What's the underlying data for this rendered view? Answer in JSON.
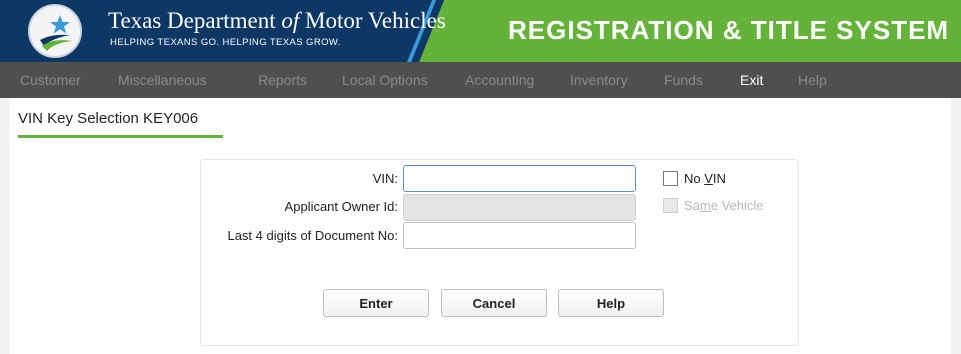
{
  "header": {
    "brand_title_pre": "Texas Department ",
    "brand_title_of": "of",
    "brand_title_post": " Motor Vehicles",
    "tagline": "HELPING TEXANS GO. HELPING TEXAS GROW.",
    "system_title": "REGISTRATION & TITLE SYSTEM",
    "colors": {
      "navy": "#0d3764",
      "green": "#64b23a"
    },
    "logo_icon": "txdmv-star-logo"
  },
  "menu": {
    "items": [
      {
        "label": "Customer",
        "active": false
      },
      {
        "label": "Miscellaneous",
        "active": false
      },
      {
        "label": "Reports",
        "active": false
      },
      {
        "label": "Local Options",
        "active": false
      },
      {
        "label": "Accounting",
        "active": false
      },
      {
        "label": "Inventory",
        "active": false
      },
      {
        "label": "Funds",
        "active": false
      },
      {
        "label": "Exit",
        "active": true
      },
      {
        "label": "Help",
        "active": false
      }
    ]
  },
  "page": {
    "title": "VIN Key Selection KEY006"
  },
  "form": {
    "vin": {
      "label": "VIN:",
      "value": ""
    },
    "owner_id": {
      "label": "Applicant Owner Id:",
      "value": ""
    },
    "doc_no": {
      "label": "Last 4 digits of Document No:",
      "value": ""
    },
    "no_vin": {
      "pre": "No ",
      "mnemonic": "V",
      "post": "IN",
      "checked": false
    },
    "same_vehicle": {
      "pre": "Sa",
      "mnemonic": "m",
      "post": "e Vehicle",
      "checked": false,
      "disabled": true
    }
  },
  "buttons": {
    "enter": "Enter",
    "cancel": "Cancel",
    "help": "Help"
  }
}
